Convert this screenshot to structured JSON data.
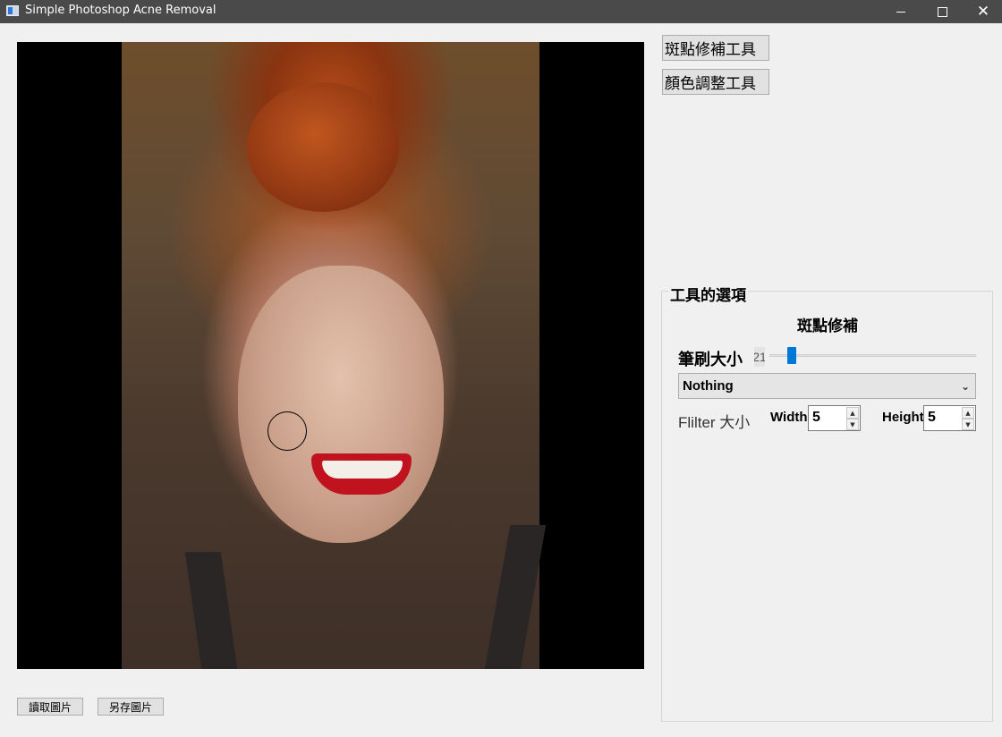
{
  "window": {
    "title": "Simple Photoshop Acne Removal",
    "minimize_glyph": "",
    "maximize_glyph": "",
    "close_glyph": "✕"
  },
  "bottom_buttons": {
    "load": "讀取圖片",
    "save": "另存圖片"
  },
  "tools": {
    "spot_repair": "斑點修補工具",
    "color_adjust": "顏色調整工具"
  },
  "options": {
    "group_title": "工具的選項",
    "section_title": "斑點修補",
    "brush_size_label": "筆刷大小",
    "brush_size_value": "21",
    "filter_select": {
      "selected": "Nothing",
      "chevron": "⌄"
    },
    "filter_size_label": "Flilter 大小",
    "width_label": "Width:",
    "width_value": "5",
    "height_label": "Height:",
    "height_value": "5",
    "spin_up": "▲",
    "spin_down": "▼"
  },
  "icons": {
    "app": "app-icon",
    "minimize": "minimize-icon",
    "maximize": "maximize-icon",
    "close": "close-icon",
    "chevron": "chevron-down-icon"
  },
  "colors": {
    "titlebar": "#4a4a4a",
    "slider_accent": "#0078d7",
    "window_bg": "#f0f0f0"
  }
}
